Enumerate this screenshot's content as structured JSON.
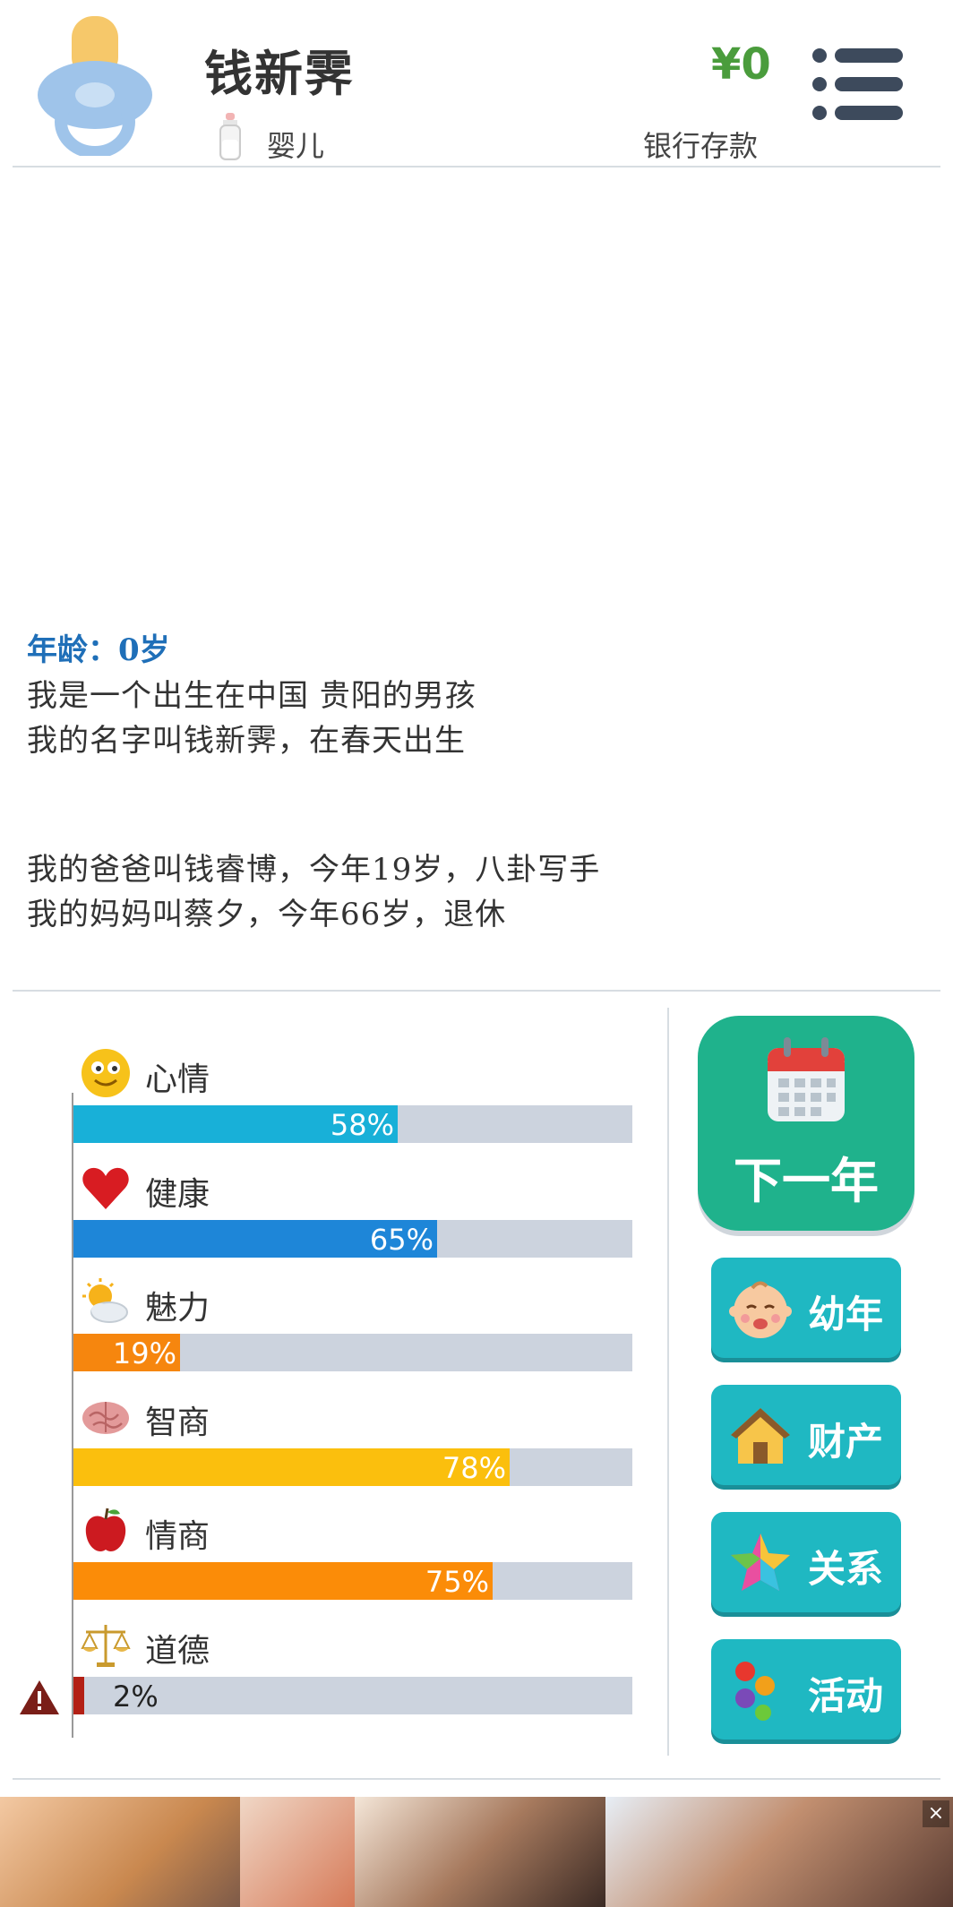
{
  "header": {
    "player_name": "钱新霁",
    "life_stage": "婴儿",
    "money": "¥0",
    "bank_label": "银行存款"
  },
  "story": {
    "age_line": "年龄：0岁",
    "lines": [
      "我是一个出生在中国 贵阳的男孩",
      "我的名字叫钱新霁，在春天出生",
      "我的爸爸叫钱睿博，今年19岁，八卦写手",
      "我的妈妈叫蔡夕，今年66岁，退休"
    ]
  },
  "stats": [
    {
      "label": "心情",
      "value": 58,
      "text": "58%",
      "color": "#18b0d8",
      "icon": "smiley-icon"
    },
    {
      "label": "健康",
      "value": 65,
      "text": "65%",
      "color": "#1e86d8",
      "icon": "heart-icon"
    },
    {
      "label": "魅力",
      "value": 19,
      "text": "19%",
      "color": "#f6860e",
      "icon": "sun-cloud-icon"
    },
    {
      "label": "智商",
      "value": 78,
      "text": "78%",
      "color": "#fbbf0d",
      "icon": "brain-icon"
    },
    {
      "label": "情商",
      "value": 75,
      "text": "75%",
      "color": "#fb8c08",
      "icon": "apple-icon"
    },
    {
      "label": "道德",
      "value": 2,
      "text": "2%",
      "color": "#b32015",
      "icon": "scales-icon"
    }
  ],
  "actions": {
    "next_year": "下一年",
    "buttons": [
      {
        "label": "幼年",
        "icon": "baby-icon"
      },
      {
        "label": "财产",
        "icon": "house-icon"
      },
      {
        "label": "关系",
        "icon": "star-icon"
      },
      {
        "label": "活动",
        "icon": "dots-icon"
      }
    ]
  },
  "colors": {
    "accent_green": "#1fb28c",
    "button_teal": "#1fb8c2",
    "money_green": "#4a9c3c",
    "age_blue": "#1f6fb8"
  }
}
